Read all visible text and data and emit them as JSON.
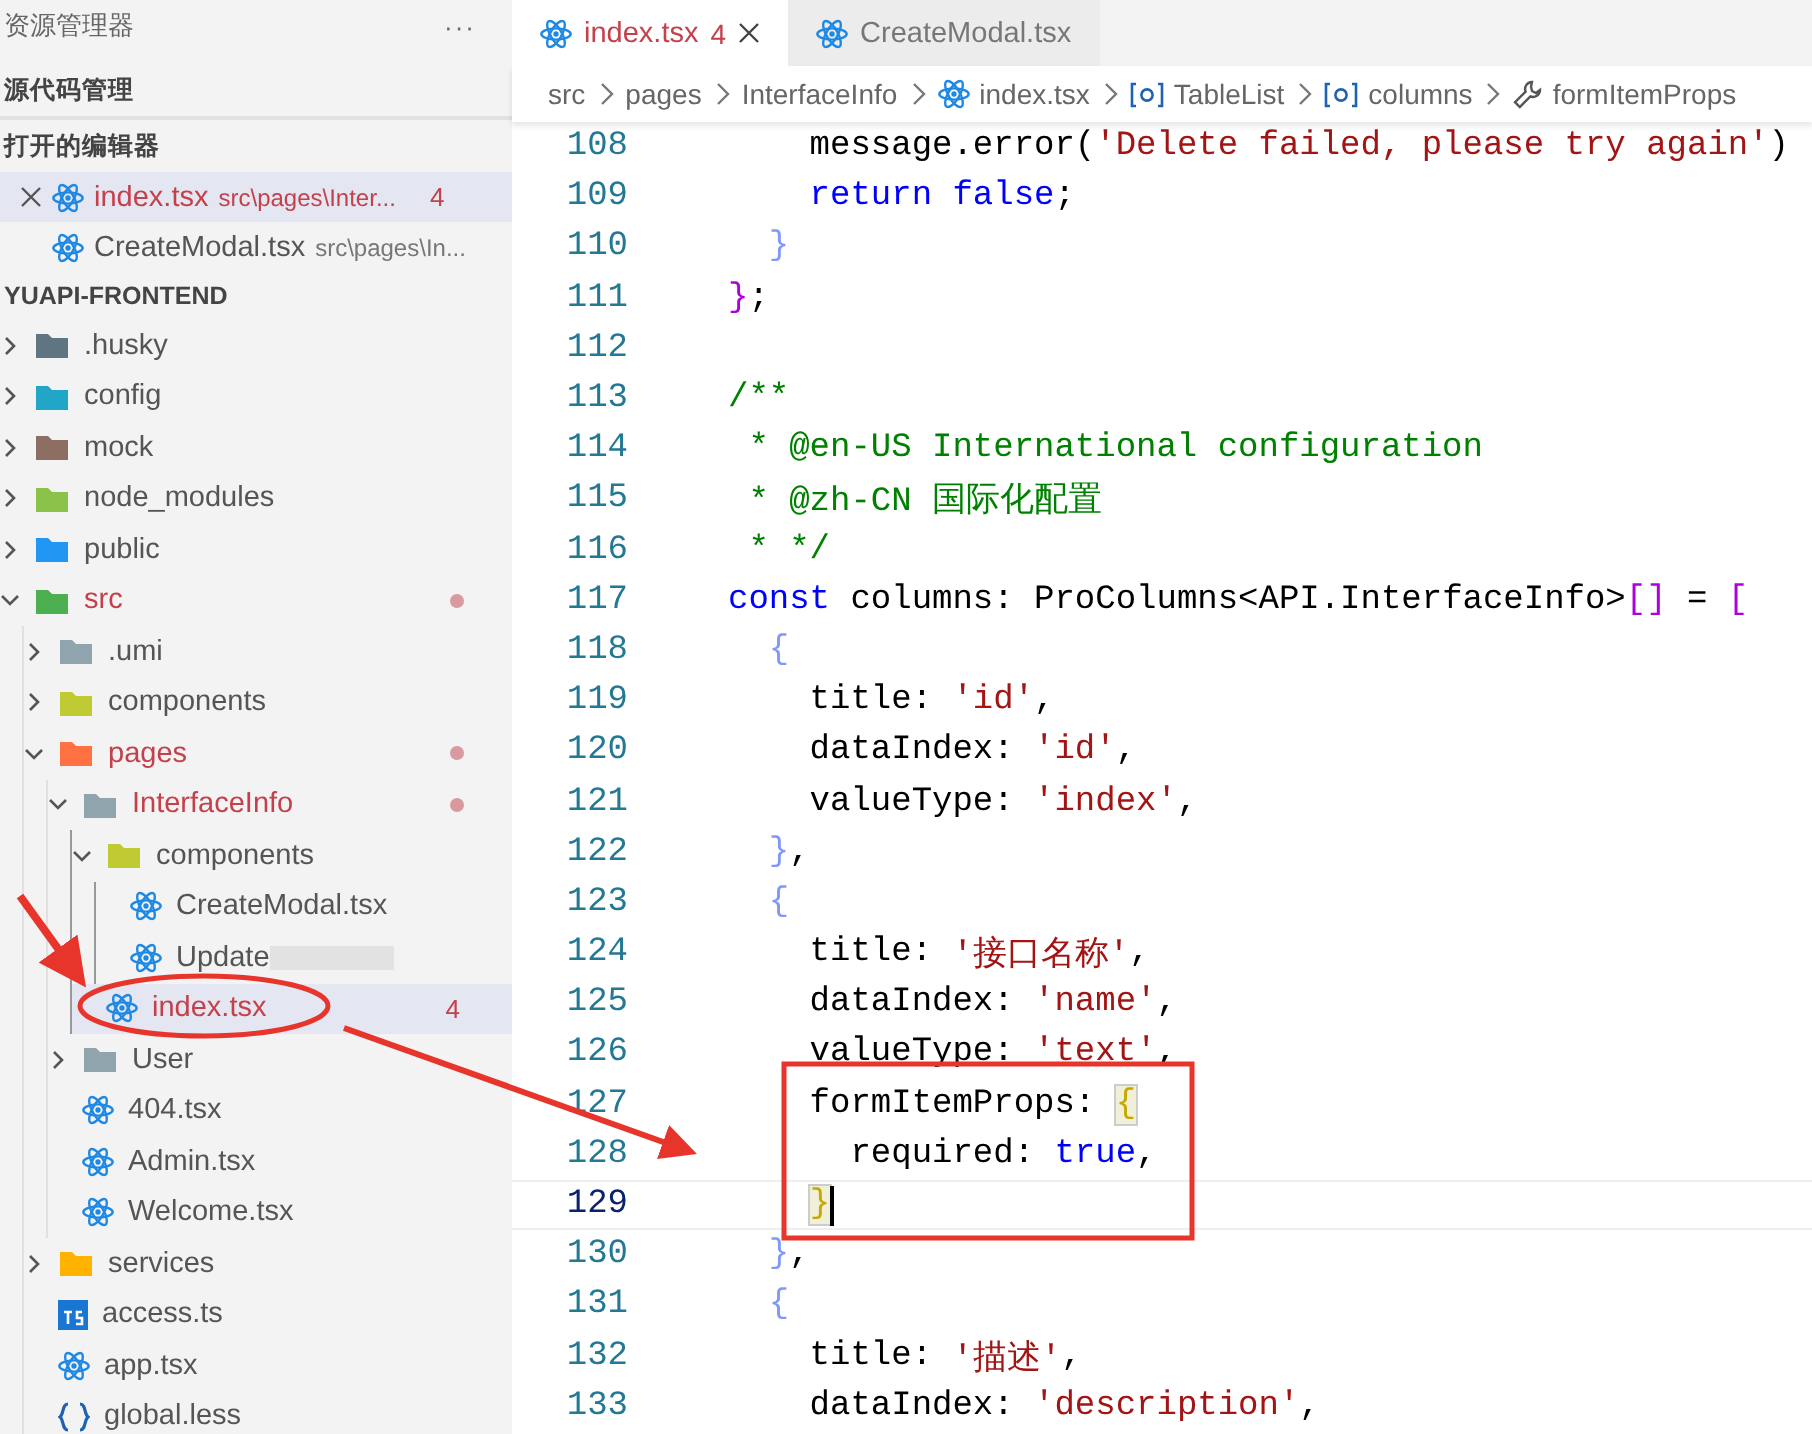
{
  "sidebar": {
    "title": "资源管理器",
    "more": "···",
    "sections": [
      {
        "title": "源代码管理"
      },
      {
        "title": "打开的编辑器"
      }
    ],
    "open_editors": [
      {
        "name": "index.tsx",
        "path": "src\\pages\\Inter...",
        "badge": "4",
        "error": true,
        "selected": true,
        "closable": true
      },
      {
        "name": "CreateModal.tsx",
        "path": "src\\pages\\In...",
        "error": false,
        "selected": false,
        "closable": false
      }
    ],
    "project": "YUAPI-FRONTEND",
    "tree": [
      {
        "name": ".husky",
        "kind": "folder",
        "color": "#5f7582",
        "expanded": false
      },
      {
        "name": "config",
        "kind": "folder",
        "color": "#22a6c8",
        "expanded": false
      },
      {
        "name": "mock",
        "kind": "folder",
        "color": "#8d6e63",
        "expanded": false
      },
      {
        "name": "node_modules",
        "kind": "folder",
        "color": "#8bc34a",
        "expanded": false
      },
      {
        "name": "public",
        "kind": "folder",
        "color": "#2196f3",
        "expanded": false
      },
      {
        "name": "src",
        "kind": "folder",
        "color": "#4caf50",
        "expanded": true,
        "error": true,
        "dot": true,
        "children": [
          {
            "name": ".umi",
            "kind": "folder",
            "color": "#90a4ae",
            "expanded": false
          },
          {
            "name": "components",
            "kind": "folder",
            "color": "#c0ca33",
            "expanded": false
          },
          {
            "name": "pages",
            "kind": "folder",
            "color": "#ff7043",
            "expanded": true,
            "error": true,
            "dot": true,
            "children": [
              {
                "name": "InterfaceInfo",
                "kind": "folder",
                "color": "#90a4ae",
                "expanded": true,
                "error": true,
                "dot": true,
                "children": [
                  {
                    "name": "components",
                    "kind": "folder",
                    "color": "#c0ca33",
                    "expanded": true,
                    "children": [
                      {
                        "name": "CreateModal.tsx",
                        "kind": "react"
                      },
                      {
                        "name": "Update",
                        "kind": "react",
                        "redacted": true
                      }
                    ]
                  },
                  {
                    "name": "index.tsx",
                    "kind": "react",
                    "error": true,
                    "badge": "4",
                    "selected": true
                  }
                ]
              },
              {
                "name": "User",
                "kind": "folder",
                "color": "#90a4ae",
                "expanded": false
              },
              {
                "name": "404.tsx",
                "kind": "react"
              },
              {
                "name": "Admin.tsx",
                "kind": "react"
              },
              {
                "name": "Welcome.tsx",
                "kind": "react"
              }
            ]
          },
          {
            "name": "services",
            "kind": "folder",
            "color": "#ffb300",
            "expanded": false
          },
          {
            "name": "access.ts",
            "kind": "ts"
          },
          {
            "name": "app.tsx",
            "kind": "react"
          },
          {
            "name": "global.less",
            "kind": "less"
          }
        ]
      }
    ]
  },
  "tabs": [
    {
      "name": "index.tsx",
      "badge": "4",
      "error": true,
      "selected": true
    },
    {
      "name": "CreateModal.tsx",
      "error": false,
      "selected": false
    }
  ],
  "breadcrumbs": [
    {
      "text": "src",
      "kind": "plain"
    },
    {
      "text": "pages",
      "kind": "plain"
    },
    {
      "text": "InterfaceInfo",
      "kind": "plain"
    },
    {
      "text": "index.tsx",
      "kind": "react"
    },
    {
      "text": "TableList",
      "kind": "symbol"
    },
    {
      "text": "columns",
      "kind": "symbol"
    },
    {
      "text": "formItemProps",
      "kind": "wrench"
    }
  ],
  "code": [
    {
      "number": "108",
      "tokens": [
        {
          "kind": "plain",
          "text": "    message.error("
        },
        {
          "kind": "string",
          "text": "'Delete failed, please try again'"
        },
        {
          "kind": "plain",
          "text": ")"
        }
      ]
    },
    {
      "number": "109",
      "tokens": [
        {
          "kind": "keyword",
          "text": "    return"
        },
        {
          "kind": "keyword",
          "text": " false"
        },
        {
          "kind": "plain",
          "text": ";"
        }
      ]
    },
    {
      "number": "110",
      "tokens": [
        {
          "kind": "bracket2",
          "text": "  }"
        }
      ]
    },
    {
      "number": "111",
      "tokens": [
        {
          "kind": "bracket1",
          "text": "}"
        },
        {
          "kind": "plain",
          "text": ";"
        }
      ]
    },
    {
      "number": "112"
    },
    {
      "number": "113",
      "tokens": [
        {
          "kind": "comment",
          "text": "/**"
        }
      ]
    },
    {
      "number": "114",
      "tokens": [
        {
          "kind": "comment",
          "text": " * @en-US International configuration"
        }
      ]
    },
    {
      "number": "115",
      "tokens": [
        {
          "kind": "comment",
          "text": " * @zh-CN 国际化配置"
        }
      ]
    },
    {
      "number": "116",
      "tokens": [
        {
          "kind": "comment",
          "text": " * */"
        }
      ]
    },
    {
      "number": "117",
      "tokens": [
        {
          "kind": "keyword",
          "text": "const"
        },
        {
          "kind": "plain",
          "text": " columns: ProColumns<API.InterfaceInfo>"
        },
        {
          "kind": "bracket1",
          "text": "[]"
        },
        {
          "kind": "plain",
          "text": " = "
        },
        {
          "kind": "bracket1",
          "text": "["
        }
      ]
    },
    {
      "number": "118",
      "tokens": [
        {
          "kind": "bracket2",
          "text": "  {"
        }
      ]
    },
    {
      "number": "119",
      "tokens": [
        {
          "kind": "plain",
          "text": "    title: "
        },
        {
          "kind": "string",
          "text": "'id'"
        },
        {
          "kind": "plain",
          "text": ","
        }
      ]
    },
    {
      "number": "120",
      "tokens": [
        {
          "kind": "plain",
          "text": "    dataIndex: "
        },
        {
          "kind": "string",
          "text": "'id'"
        },
        {
          "kind": "plain",
          "text": ","
        }
      ]
    },
    {
      "number": "121",
      "tokens": [
        {
          "kind": "plain",
          "text": "    valueType: "
        },
        {
          "kind": "string",
          "text": "'index'"
        },
        {
          "kind": "plain",
          "text": ","
        }
      ]
    },
    {
      "number": "122",
      "tokens": [
        {
          "kind": "bracket2",
          "text": "  }"
        },
        {
          "kind": "plain",
          "text": ","
        }
      ]
    },
    {
      "number": "123",
      "tokens": [
        {
          "kind": "bracket2",
          "text": "  {"
        }
      ]
    },
    {
      "number": "124",
      "tokens": [
        {
          "kind": "plain",
          "text": "    title: "
        },
        {
          "kind": "string",
          "text": "'接口名称'"
        },
        {
          "kind": "plain",
          "text": ","
        }
      ]
    },
    {
      "number": "125",
      "tokens": [
        {
          "kind": "plain",
          "text": "    dataIndex: "
        },
        {
          "kind": "string",
          "text": "'name'"
        },
        {
          "kind": "plain",
          "text": ","
        }
      ]
    },
    {
      "number": "126",
      "tokens": [
        {
          "kind": "plain",
          "text": "    valueType: "
        },
        {
          "kind": "string",
          "text": "'text'"
        },
        {
          "kind": "plain",
          "text": ","
        }
      ]
    },
    {
      "number": "127",
      "tokens": [
        {
          "kind": "plain",
          "text": "    formItemProps: "
        },
        {
          "kind": "match",
          "text": "{"
        }
      ]
    },
    {
      "number": "128",
      "tokens": [
        {
          "kind": "plain",
          "text": "      required: "
        },
        {
          "kind": "keyword",
          "text": "true"
        },
        {
          "kind": "plain",
          "text": ","
        }
      ]
    },
    {
      "number": "129",
      "current": true,
      "tokens": [
        {
          "kind": "match",
          "text": "    }"
        }
      ]
    },
    {
      "number": "130",
      "tokens": [
        {
          "kind": "bracket2",
          "text": "  }"
        },
        {
          "kind": "plain",
          "text": ","
        }
      ]
    },
    {
      "number": "131",
      "tokens": [
        {
          "kind": "bracket2",
          "text": "  {"
        }
      ]
    },
    {
      "number": "132",
      "tokens": [
        {
          "kind": "plain",
          "text": "    title: "
        },
        {
          "kind": "string",
          "text": "'描述'"
        },
        {
          "kind": "plain",
          "text": ","
        }
      ]
    },
    {
      "number": "133",
      "tokens": [
        {
          "kind": "plain",
          "text": "    dataIndex: "
        },
        {
          "kind": "string",
          "text": "'description'"
        },
        {
          "kind": "plain",
          "text": ","
        }
      ]
    }
  ]
}
